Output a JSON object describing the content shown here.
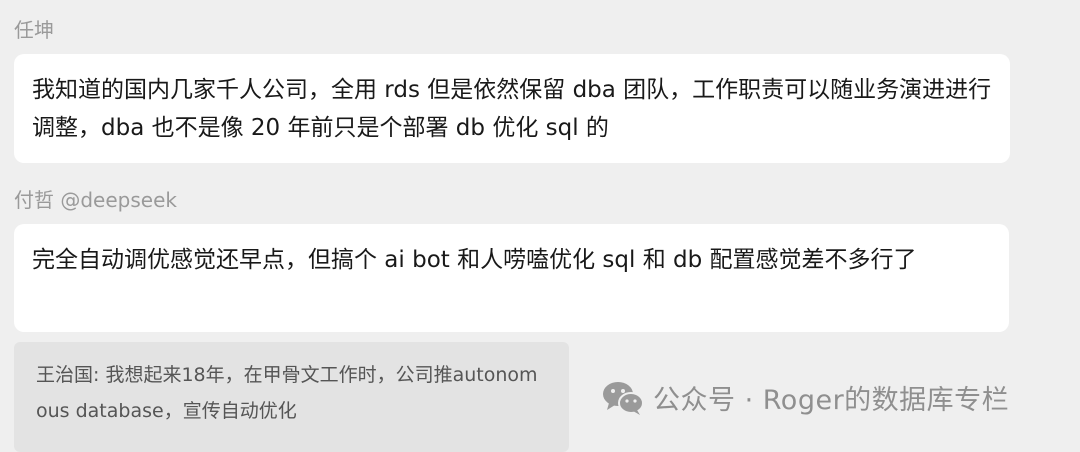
{
  "messages": [
    {
      "sender": "任坤",
      "text": "我知道的国内几家千人公司，全用 rds 但是依然保留 dba 团队，工作职责可以随业务演进进行调整，dba 也不是像 20 年前只是个部署 db 优化 sql 的"
    },
    {
      "sender": "付哲 @deepseek",
      "text": "完全自动调优感觉还早点，但搞个 ai bot 和人唠嗑优化 sql 和 db 配置感觉差不多行了"
    }
  ],
  "quote": {
    "text": "王治国: 我想起来18年，在甲骨文工作时，公司推autonomous database，宣传自动优化"
  },
  "watermark": {
    "text": "公众号 · Roger的数据库专栏",
    "icon": "wechat-icon",
    "color": "#8f8f8f"
  }
}
